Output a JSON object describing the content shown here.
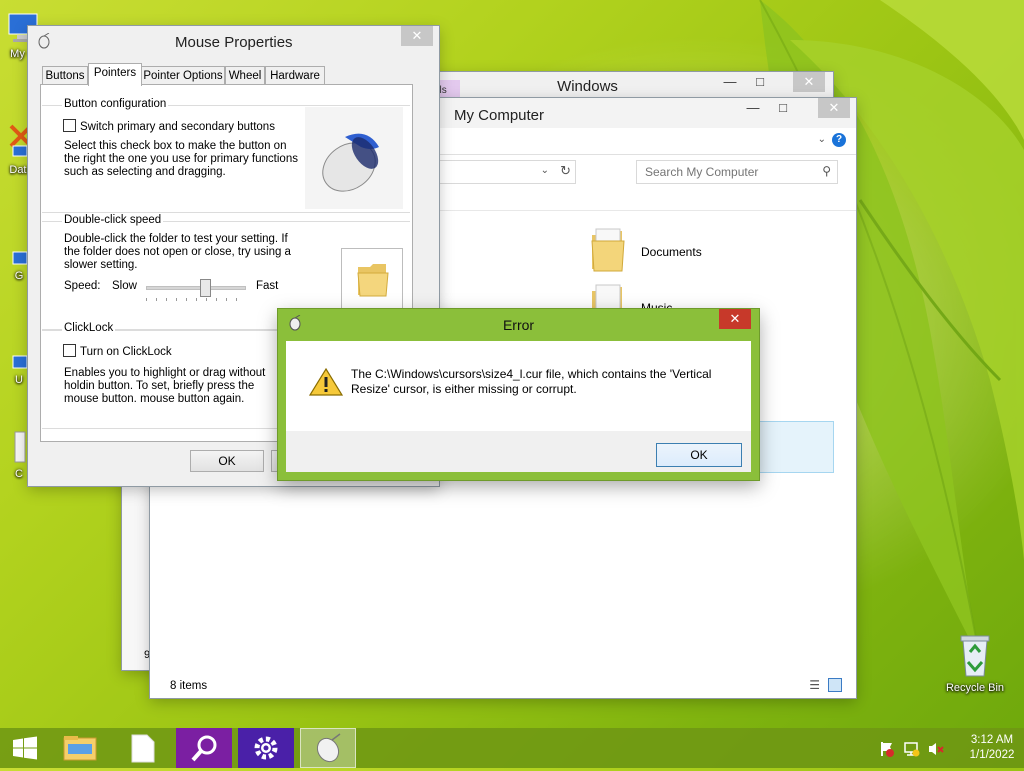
{
  "desktop": {
    "icons": [
      {
        "label": "My C",
        "icon": "computer-icon"
      },
      {
        "label": "Data",
        "icon": "shortcut-icon"
      },
      {
        "label": "G",
        "icon": "shortcut-icon"
      },
      {
        "label": "U",
        "icon": "shortcut-icon"
      },
      {
        "label": "C",
        "icon": "shortcut-icon"
      },
      {
        "label": "Recycle Bin",
        "icon": "recycle-bin-icon"
      }
    ]
  },
  "windows_back": {
    "title": "Windows",
    "ribbon_tab_fragment": "ols"
  },
  "explorer": {
    "title": "My Computer",
    "search_placeholder": "Search My Computer",
    "folders": [
      {
        "label": "Documents"
      },
      {
        "label": "Music"
      }
    ],
    "status": "8 items",
    "left_fragment": "9"
  },
  "mouse_properties": {
    "title": "Mouse Properties",
    "tabs": [
      "Buttons",
      "Pointers",
      "Pointer Options",
      "Wheel",
      "Hardware"
    ],
    "active_tab": "Pointers",
    "button_config": {
      "heading": "Button configuration",
      "checkbox_label": "Switch primary and secondary buttons",
      "description": "Select this check box to make the button on the right the one you use for primary functions such as selecting and dragging."
    },
    "double_click": {
      "heading": "Double-click speed",
      "description": "Double-click the folder to test your setting. If the folder does not open or close, try using a slower setting.",
      "speed_label": "Speed:",
      "slow": "Slow",
      "fast": "Fast",
      "speed_value": 0.6
    },
    "clicklock": {
      "heading": "ClickLock",
      "checkbox_label": "Turn on ClickLock",
      "description": "Enables you to highlight or drag without holdin button. To set, briefly press the mouse button. mouse button again."
    },
    "ok_label": "OK"
  },
  "error_dialog": {
    "title": "Error",
    "message": "The C:\\Windows\\cursors\\size4_l.cur file, which contains the 'Vertical Resize' cursor, is either missing or corrupt.",
    "ok_label": "OK",
    "accent": "#8bbf3a"
  },
  "taskbar": {
    "items": [
      "start-icon",
      "file-explorer-icon",
      "document-icon",
      "search-icon",
      "settings-icon",
      "mouse-icon"
    ],
    "time": "3:12 AM",
    "date": "1/1/2022"
  },
  "colors": {
    "accent": "#8bbf3a",
    "close_red": "#c7392a",
    "taskbar_purple": "#7b1fa2"
  }
}
